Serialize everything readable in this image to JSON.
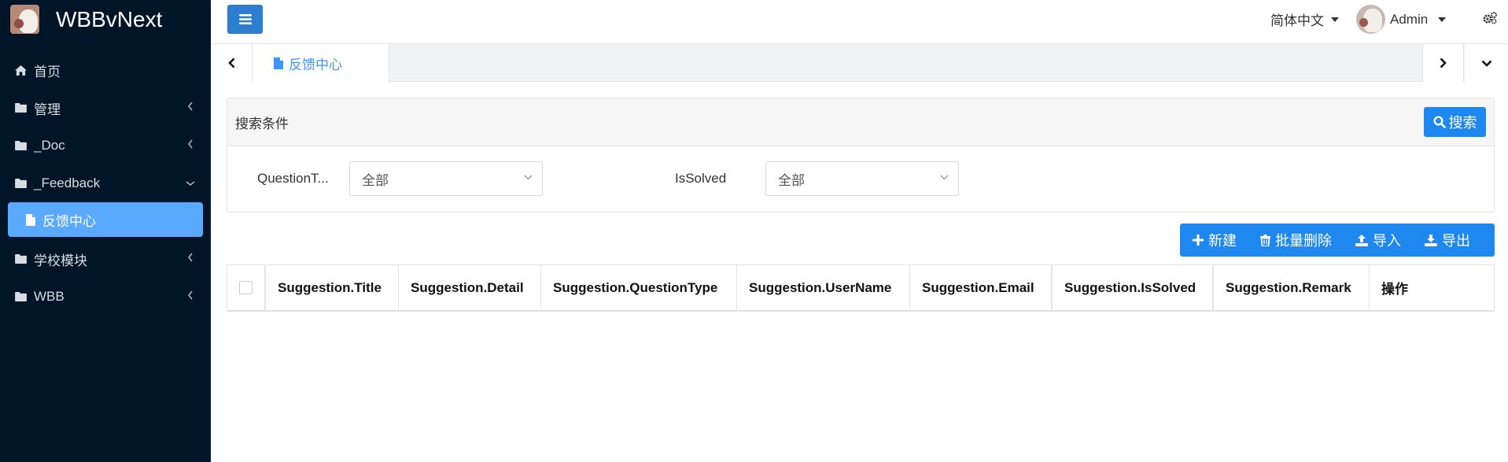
{
  "app": {
    "title": "WBBvNext"
  },
  "sidebar": {
    "items": [
      {
        "label": "首页",
        "icon": "home-icon"
      },
      {
        "label": "管理",
        "icon": "folder-icon",
        "chevron": "chevron-left-icon"
      },
      {
        "label": "_Doc",
        "icon": "folder-icon",
        "chevron": "chevron-left-icon"
      },
      {
        "label": "_Feedback",
        "icon": "folder-icon",
        "chevron": "chevron-down-icon",
        "expanded": true
      },
      {
        "label": "学校模块",
        "icon": "folder-icon",
        "chevron": "chevron-left-icon"
      },
      {
        "label": "WBB",
        "icon": "folder-icon",
        "chevron": "chevron-left-icon"
      }
    ],
    "subitem": {
      "label": "反馈中心",
      "icon": "file-icon",
      "active": true
    }
  },
  "header": {
    "language": "简体中文",
    "user": "Admin"
  },
  "tabs": [
    {
      "label": "反馈中心",
      "icon": "file-icon",
      "active": true
    }
  ],
  "search": {
    "title": "搜索条件",
    "button_label": "搜索",
    "fields": [
      {
        "label": "QuestionT...",
        "value": "全部"
      },
      {
        "label": "IsSolved",
        "value": "全部"
      }
    ]
  },
  "toolbar": {
    "new_label": "新建",
    "batch_delete_label": "批量删除",
    "import_label": "导入",
    "export_label": "导出"
  },
  "table": {
    "columns": [
      "Suggestion.Title",
      "Suggestion.Detail",
      "Suggestion.QuestionType",
      "Suggestion.UserName",
      "Suggestion.Email",
      "Suggestion.IsSolved",
      "Suggestion.Remark",
      "操作"
    ],
    "rows": []
  },
  "colors": {
    "sidebar_bg": "#011529",
    "active_item": "#59a9ff",
    "primary": "#1e88f0",
    "tab_active_text": "#3b97f2"
  }
}
